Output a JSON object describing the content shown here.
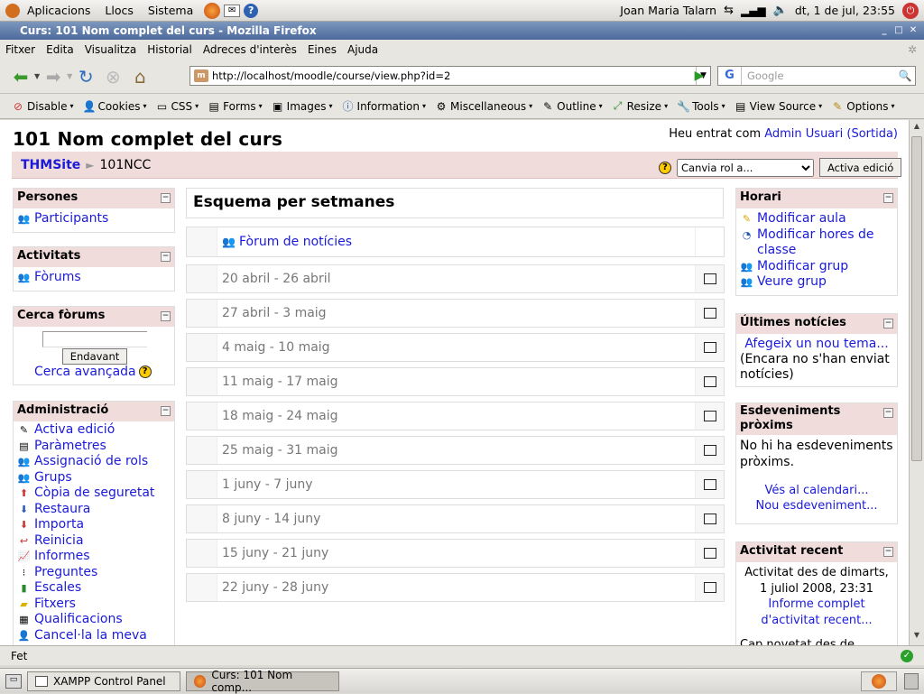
{
  "gnome_top": {
    "menus": [
      "Aplicacions",
      "Llocs",
      "Sistema"
    ],
    "user": "Joan Maria Talarn",
    "clock": "dt,   1 de jul, 23:55"
  },
  "window": {
    "title": "Curs: 101 Nom complet del curs - Mozilla Firefox"
  },
  "menubar": [
    "Fitxer",
    "Edita",
    "Visualitza",
    "Historial",
    "Adreces d'interès",
    "Eines",
    "Ajuda"
  ],
  "navigation": {
    "url": "http://localhost/moodle/course/view.php?id=2",
    "search_placeholder": "Google"
  },
  "webdev_toolbar": [
    {
      "label": "Disable",
      "icon": "⊘"
    },
    {
      "label": "Cookies",
      "icon": "👤"
    },
    {
      "label": "CSS",
      "icon": "▭"
    },
    {
      "label": "Forms",
      "icon": "▤"
    },
    {
      "label": "Images",
      "icon": "▣"
    },
    {
      "label": "Information",
      "icon": "ⓘ"
    },
    {
      "label": "Miscellaneous",
      "icon": "⚙"
    },
    {
      "label": "Outline",
      "icon": "✎"
    },
    {
      "label": "Resize",
      "icon": "⤢"
    },
    {
      "label": "Tools",
      "icon": "🔧"
    },
    {
      "label": "View Source",
      "icon": "▤"
    },
    {
      "label": "Options",
      "icon": "✎"
    }
  ],
  "course": {
    "title": "101 Nom complet del curs",
    "login_prefix": "Heu entrat com",
    "login_user": "Admin Usuari",
    "logout": "(Sortida)",
    "breadcrumb_site": "THMSite",
    "breadcrumb_course": "101NCC",
    "role_select": "Canvia rol a...",
    "edit_button": "Activa edició"
  },
  "blocks_left": {
    "persones": {
      "title": "Persones",
      "items": [
        "Participants"
      ]
    },
    "activitats": {
      "title": "Activitats",
      "items": [
        "Fòrums"
      ]
    },
    "cerca": {
      "title": "Cerca fòrums",
      "button": "Endavant",
      "advanced": "Cerca avançada"
    },
    "admin": {
      "title": "Administració",
      "items": [
        "Activa edició",
        "Paràmetres",
        "Assignació de rols",
        "Grups",
        "Còpia de seguretat",
        "Restaura",
        "Importa",
        "Reinicia",
        "Informes",
        "Preguntes",
        "Escales",
        "Fitxers",
        "Qualificacions",
        "Cancel·la la meva"
      ]
    }
  },
  "main": {
    "title": "Esquema per setmanes",
    "forum": "Fòrum de notícies",
    "weeks": [
      "20 abril - 26 abril",
      "27 abril - 3 maig",
      "4 maig - 10 maig",
      "11 maig - 17 maig",
      "18 maig - 24 maig",
      "25 maig - 31 maig",
      "1 juny - 7 juny",
      "8 juny - 14 juny",
      "15 juny - 21 juny",
      "22 juny - 28 juny"
    ]
  },
  "blocks_right": {
    "horari": {
      "title": "Horari",
      "items": [
        "Modificar aula",
        "Modificar hores de classe",
        "Modificar grup",
        "Veure grup"
      ]
    },
    "noticies": {
      "title": "Últimes notícies",
      "link": "Afegeix un nou tema...",
      "empty": "(Encara no s'han enviat notícies)"
    },
    "esdeveniments": {
      "title": "Esdeveniments pròxims",
      "empty": "No hi ha esdeveniments pròxims.",
      "calendar": "Vés al calendari...",
      "new": "Nou esdeveniment..."
    },
    "recent": {
      "title": "Activitat recent",
      "since": "Activitat des de dimarts, 1 juliol 2008, 23:31",
      "report": "Informe complet d'activitat recent...",
      "more": "Cap novetat des de"
    }
  },
  "status": {
    "text": "Fet"
  },
  "taskbar": [
    "XAMPP Control Panel",
    "Curs: 101 Nom comp..."
  ]
}
